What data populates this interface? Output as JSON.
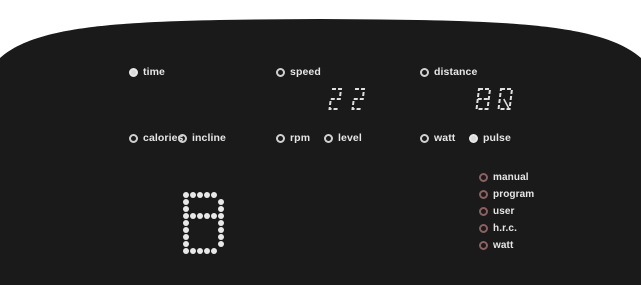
{
  "panel": {
    "indicators": {
      "time": {
        "label": "time",
        "lit": true
      },
      "speed": {
        "label": "speed",
        "lit": false
      },
      "distance": {
        "label": "distance",
        "lit": false
      },
      "calories": {
        "label": "calories",
        "lit": false
      },
      "incline": {
        "label": "incline",
        "lit": false
      },
      "rpm": {
        "label": "rpm",
        "lit": false
      },
      "level": {
        "label": "level",
        "lit": false
      },
      "watt": {
        "label": "watt",
        "lit": false
      },
      "pulse": {
        "label": "pulse",
        "lit": true
      }
    },
    "displays": {
      "left": {
        "value": "22"
      },
      "right": {
        "value": "80"
      }
    },
    "program_matrix": {
      "character": "B"
    },
    "modes": [
      {
        "label": "manual"
      },
      {
        "label": "program"
      },
      {
        "label": "user"
      },
      {
        "label": "h.r.c."
      },
      {
        "label": "watt"
      }
    ]
  },
  "colors": {
    "panel": "#1a1a1a",
    "segment": "#e0e0e0",
    "indicator_lit": "#d9d9d9",
    "mode_ring": "#8a6060"
  }
}
